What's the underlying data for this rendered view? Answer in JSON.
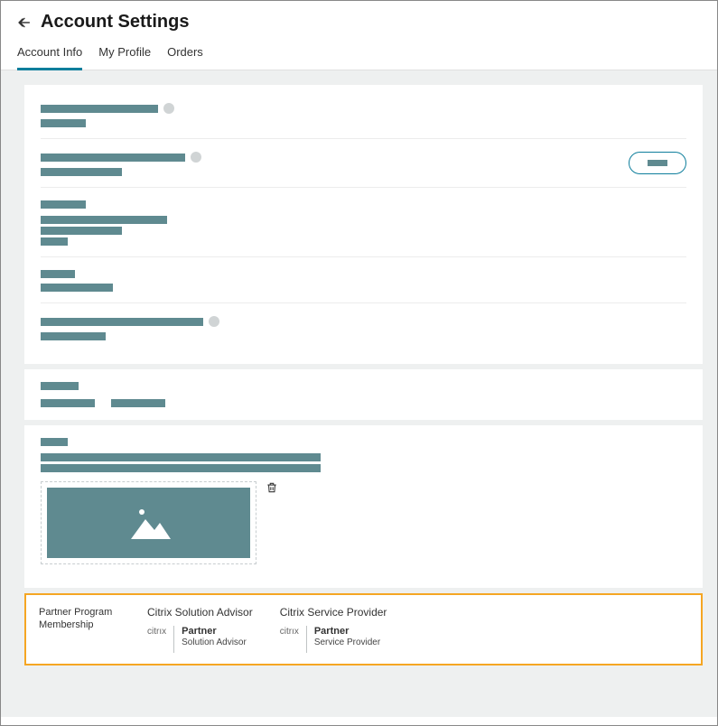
{
  "page": {
    "title": "Account Settings"
  },
  "tabs": [
    {
      "label": "Account Info",
      "active": true
    },
    {
      "label": "My Profile",
      "active": false
    },
    {
      "label": "Orders",
      "active": false
    }
  ],
  "partner_program": {
    "label": "Partner Program Membership",
    "items": [
      {
        "title": "Citrix Solution Advisor",
        "vendor": "citrıx",
        "partner_label": "Partner",
        "subtype": "Solution Advisor"
      },
      {
        "title": "Citrix Service Provider",
        "vendor": "citrıx",
        "partner_label": "Partner",
        "subtype": "Service Provider"
      }
    ]
  }
}
